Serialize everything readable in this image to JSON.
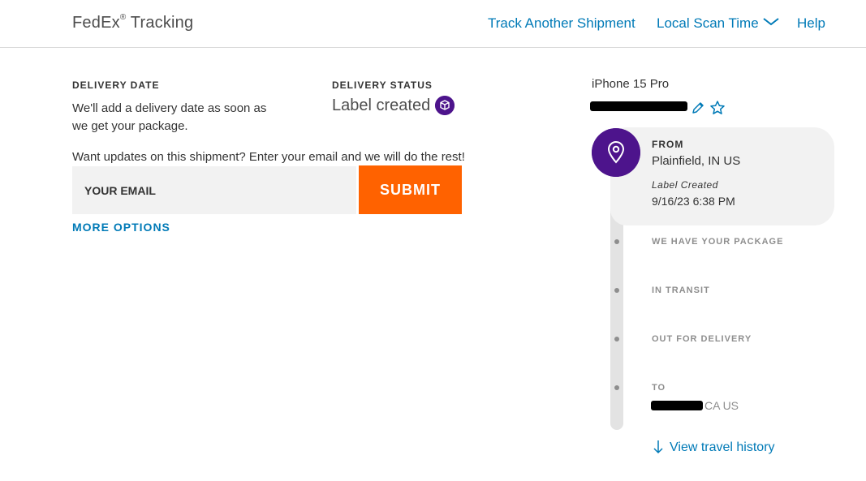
{
  "header": {
    "brand": "FedEx",
    "brand_mark": "®",
    "brand_suffix": " Tracking",
    "nav": {
      "track_another": "Track Another Shipment",
      "local_scan_time": "Local Scan Time",
      "help": "Help"
    }
  },
  "delivery": {
    "date_label": "DELIVERY DATE",
    "date_text": "We'll add a delivery date as soon as we get your package.",
    "status_label": "DELIVERY STATUS",
    "status_text": "Label created"
  },
  "updates": {
    "prompt": "Want updates on this shipment? Enter your email and we will do the rest!",
    "email_placeholder": "YOUR EMAIL",
    "submit_label": "SUBMIT",
    "more_options": "MORE OPTIONS"
  },
  "shipment": {
    "nickname": "iPhone 15 Pro",
    "tracking_number_redacted": true
  },
  "timeline": {
    "from": {
      "label": "FROM",
      "location": "Plainfield, IN US",
      "status": "Label Created",
      "datetime": "9/16/23 6:38 PM"
    },
    "steps": [
      {
        "label": "WE HAVE YOUR PACKAGE"
      },
      {
        "label": "IN TRANSIT"
      },
      {
        "label": "OUT FOR DELIVERY"
      }
    ],
    "to": {
      "label": "TO",
      "location_suffix": "CA US"
    },
    "view_history": "View travel history"
  },
  "colors": {
    "fedex_purple": "#4d148c",
    "fedex_orange": "#ff6200",
    "link_blue": "#007ab7",
    "muted_gray": "#8e8e8e"
  },
  "icons": [
    "chevron-down-icon",
    "package-icon",
    "pencil-icon",
    "star-icon",
    "location-pin-icon",
    "arrow-down-icon"
  ]
}
